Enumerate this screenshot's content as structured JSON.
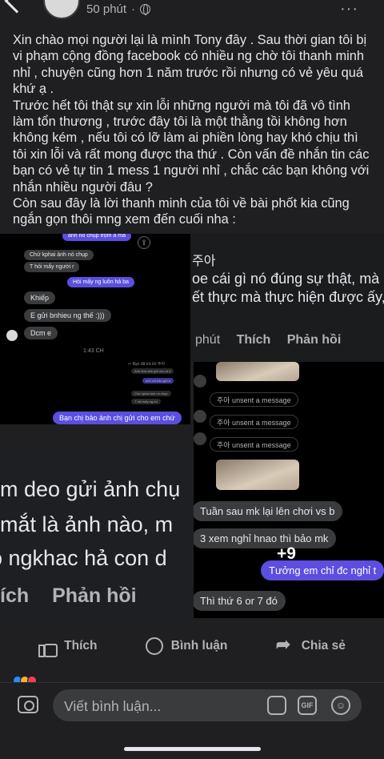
{
  "header": {
    "time": "50 phút",
    "separator": "·"
  },
  "post": {
    "paragraphs": [
      "Xin chào mọi người lại là mình Tony đây . Sau thời gian tôi bị vi phạm cộng đồng facebook có nhiều ng chờ tôi thanh minh nhỉ , chuyện cũng hơn 1 năm trước rồi nhưng có vẻ yêu quá khứ ạ .",
      "Trước hết tôi thật sự xin lỗi những người mà tôi đã vô tình làm tổn thương , trước đây tôi là một thằng tồi không hơn không kém , nếu tôi có lỡ làm ai phiền lòng hay khó chịu thì tôi xin lỗi và rất mong được tha thứ . Còn vấn đề nhắn tin các bạn có vẻ tự tin 1 mess 1 người nhỉ , chắc các bạn không với nhắn nhiều người đâu ?",
      "Còn sau đây là lời thanh minh của tôi về bài phốt kia cũng ngắn gọn thôi mng xem đến cuối nha :"
    ]
  },
  "collage": {
    "tile1": {
      "top_out": "ảnh nó chụp trộm à mà",
      "share": "⇪",
      "in1": "Chứ kphai ảnh nó chụp",
      "in2": "T hỏi mấy người r",
      "out1": "Hỏi mấy ng luôn hả ba",
      "in3": "Khiếp",
      "in4": "E gửi bnhieu ng thế :)))",
      "in5": "Dcm e",
      "time": "1:43 CH",
      "reply_note": "↩ Bạn đã trả lời 주아",
      "faint1": "Anh đưa ảnh gửi cho ai à",
      "faint2": "anh chị bảo gửi à",
      "faint3": "Chứ kphai ảnh nó chụp",
      "faint4": "T hỏi mấy ng rồi",
      "out_big": "Bạn chị bảo ảnh chị gửi cho em chứ"
    },
    "tile2": {
      "name_fragment": "주아",
      "line1": "oe cái gì nó đúng sự thật, mà",
      "line2": "ết thực mà thực hiện được ấy,",
      "time": "phút",
      "like": "Thích",
      "reply": "Phản hồi"
    },
    "tile3": {
      "unsent1": "주아 unsent a message",
      "unsent2": "주아 unsent a message",
      "unsent3": "주아 unsent a message"
    },
    "tile4": {
      "line1": "m deo gửi ảnh chụ",
      "line2": "mắt là ảnh nào, m",
      "line3": "o ngkhac hả con d",
      "actions_like": "ích",
      "actions_reply": "Phản hồi"
    },
    "tile5": {
      "msg1": "Tuần sau mk lại lên chơi vs b",
      "msg2": "3 xem nghỉ hnao thì bảo mk",
      "msg3": "Tưởng em chỉ đc nghỉ t",
      "msg4": "Thì thứ 6 or 7 đó"
    },
    "more_count": "+9"
  },
  "actions": {
    "like": "Thích",
    "comment": "Bình luận",
    "share": "Chia sẻ"
  },
  "composer": {
    "placeholder": "Viết bình luận...",
    "gif": "GIF",
    "emoji": "☺"
  },
  "reaction_colors": [
    "#2d88ff",
    "#f7b125",
    "#f33e58"
  ]
}
